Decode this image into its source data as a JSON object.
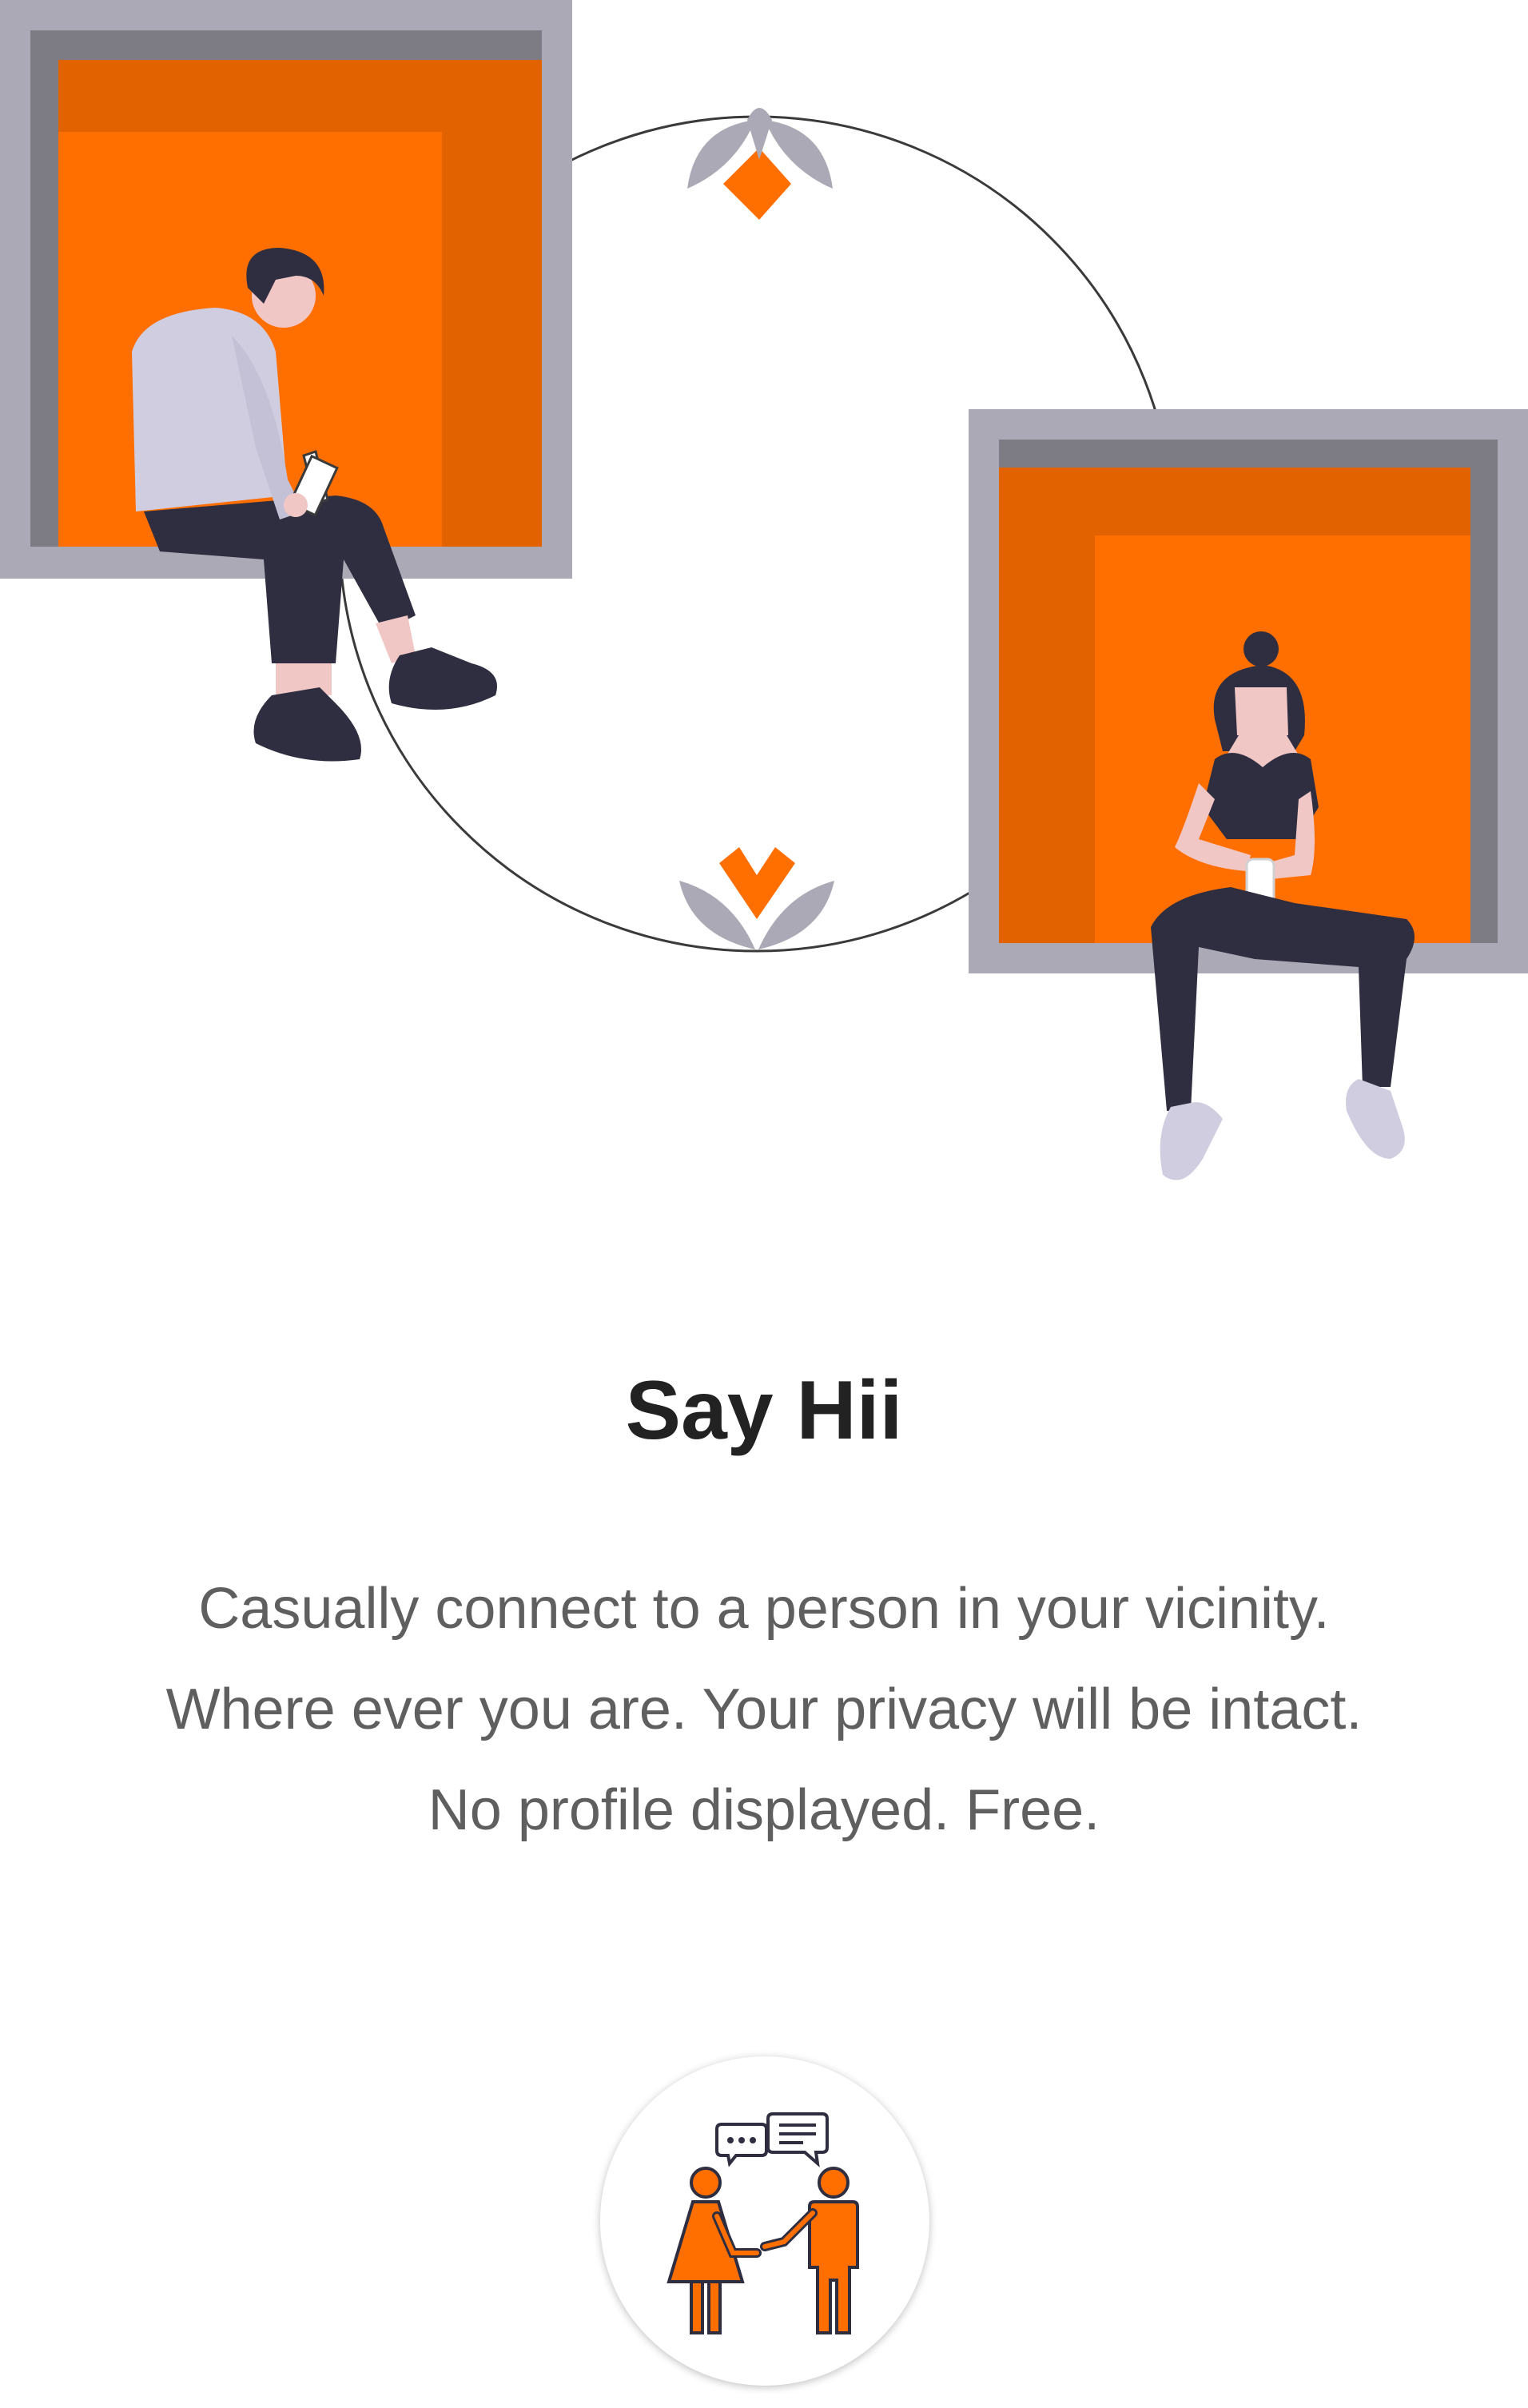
{
  "onboarding": {
    "title": "Say Hii",
    "description_lines": [
      "Casually connect to a person in your vicinity.",
      "Where ever you are. Your privacy will be intact.",
      "No profile displayed. Free."
    ]
  },
  "illustration": {
    "icon": "two-people-in-windows-illustration"
  },
  "action_button": {
    "icon": "people-chatting-icon"
  },
  "colors": {
    "accent": "#FF6F00",
    "accent_dark": "#E36200",
    "frame_gray": "#ABA9B5",
    "frame_dark": "#7D7B83",
    "figure_dark": "#2F2E41",
    "title_text": "#222222",
    "body_text": "#5F5F5F"
  }
}
